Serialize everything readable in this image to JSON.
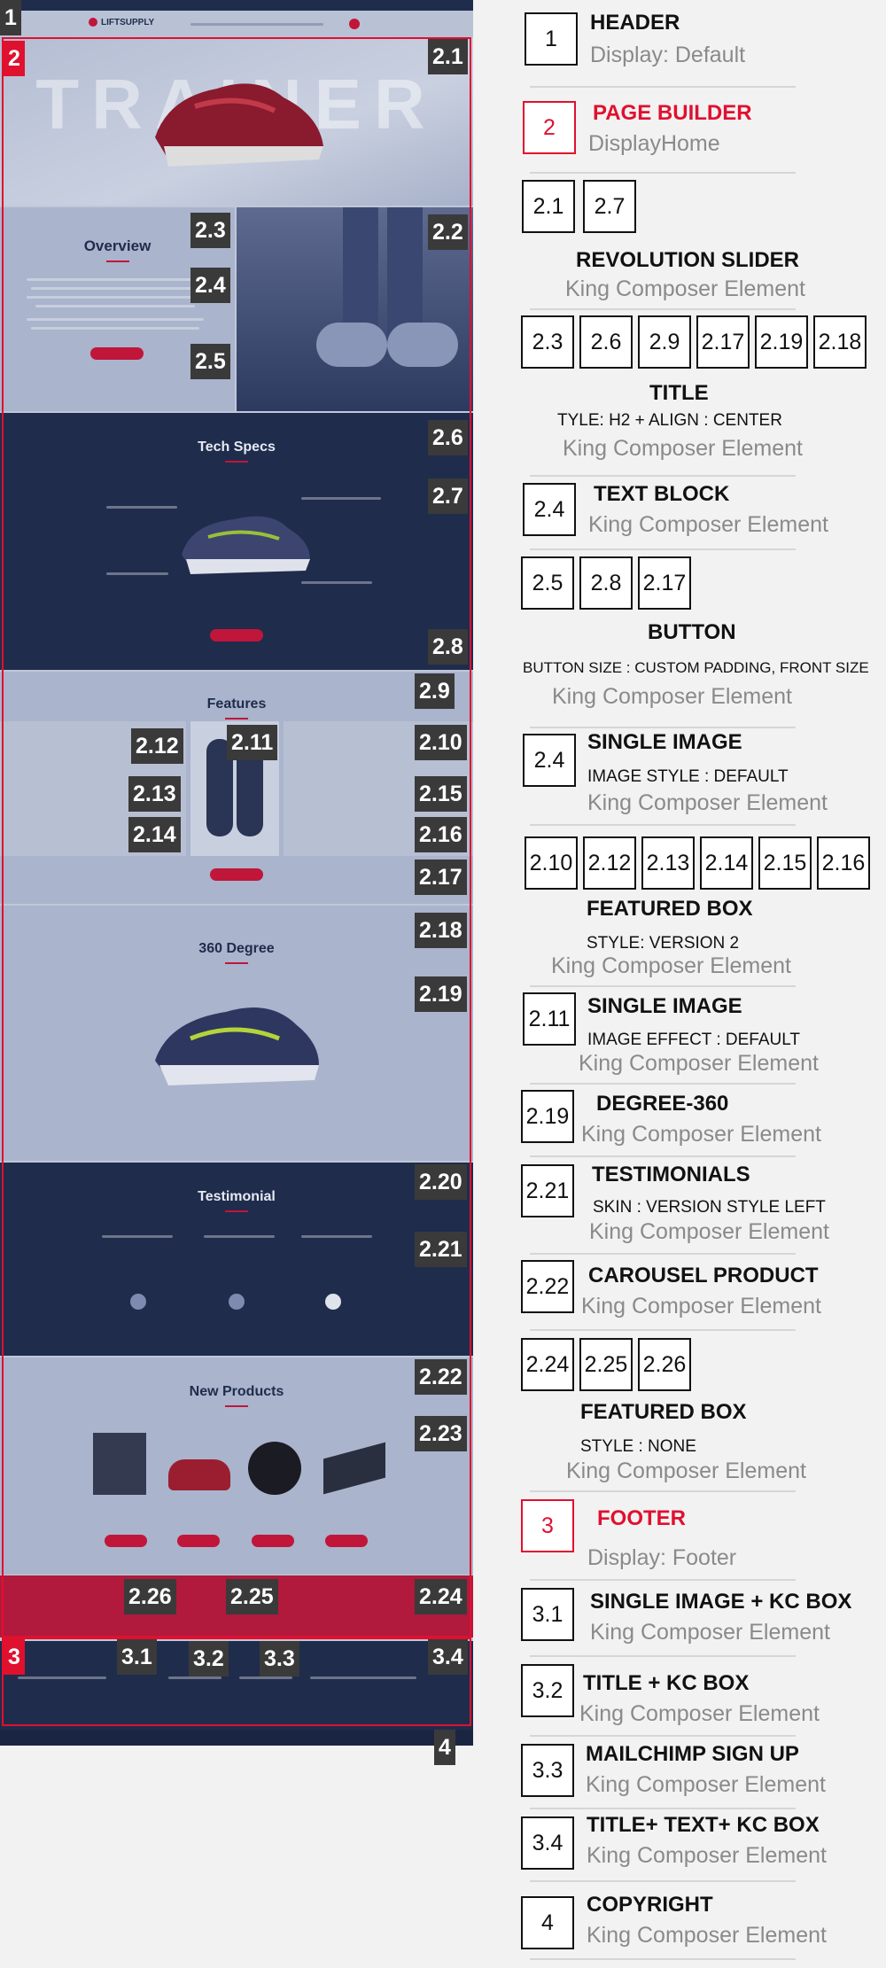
{
  "mockup": {
    "brand": "LIFTSUPPLY",
    "hero_word": "TRAINER",
    "overview_title": "Overview",
    "tech_title": "Tech Specs",
    "features_title": "Features",
    "degree_title": "360 Degree",
    "testimonial_title": "Testimonial",
    "products_title": "New Products",
    "labels": [
      "2",
      "2.1",
      "2.2",
      "2.3",
      "2.4",
      "2.5",
      "2.6",
      "2.7",
      "2.8",
      "2.9",
      "2.10",
      "2.11",
      "2.12",
      "2.13",
      "2.14",
      "2.15",
      "2.16",
      "2.17",
      "2.18",
      "2.19",
      "2.20",
      "2.21",
      "2.22",
      "2.23",
      "2.24",
      "2.25",
      "2.26",
      "3",
      "3.1",
      "3.2",
      "3.3",
      "3.4",
      "1",
      "4"
    ]
  },
  "legend": {
    "items": [
      {
        "boxes": [
          "1"
        ],
        "title": "HEADER",
        "subtitle": "Display: Default"
      },
      {
        "boxes": [
          "2"
        ],
        "title": "PAGE BUILDER",
        "subtitle": "DisplayHome",
        "red": true
      },
      {
        "boxes": [
          "2.1",
          "2.7"
        ],
        "title": "REVOLUTION SLIDER",
        "subtitle": "King Composer Element"
      },
      {
        "boxes": [
          "2.3",
          "2.6",
          "2.9",
          "2.17",
          "2.19",
          "2.18"
        ],
        "title": "TITLE",
        "note": "TYLE: H2 + ALIGN : CENTER",
        "subtitle": "King Composer Element"
      },
      {
        "boxes": [
          "2.4"
        ],
        "title": "TEXT BLOCK",
        "subtitle": "King Composer Element"
      },
      {
        "boxes": [
          "2.5",
          "2.8",
          "2.17"
        ],
        "title": "BUTTON",
        "note": "BUTTON SIZE : CUSTOM PADDING, FRONT SIZE",
        "subtitle": "King Composer Element"
      },
      {
        "boxes": [
          "2.4"
        ],
        "title": "SINGLE IMAGE",
        "note": "IMAGE STYLE : DEFAULT",
        "subtitle": "King Composer Element"
      },
      {
        "boxes": [
          "2.10",
          "2.12",
          "2.13",
          "2.14",
          "2.15",
          "2.16"
        ],
        "title": "FEATURED BOX",
        "note": "STYLE: VERSION 2",
        "subtitle": "King Composer Element"
      },
      {
        "boxes": [
          "2.11"
        ],
        "title": "SINGLE IMAGE",
        "note": "IMAGE EFFECT : DEFAULT",
        "subtitle": "King Composer Element"
      },
      {
        "boxes": [
          "2.19"
        ],
        "title": "DEGREE-360",
        "subtitle": "King Composer Element"
      },
      {
        "boxes": [
          "2.21"
        ],
        "title": "TESTIMONIALS",
        "note": "SKIN : VERSION STYLE LEFT",
        "subtitle": "King Composer Element"
      },
      {
        "boxes": [
          "2.22"
        ],
        "title": "CAROUSEL PRODUCT",
        "subtitle": "King Composer Element"
      },
      {
        "boxes": [
          "2.24",
          "2.25",
          "2.26"
        ],
        "title": "FEATURED BOX",
        "note": "STYLE : NONE",
        "subtitle": "King Composer Element"
      },
      {
        "boxes": [
          "3"
        ],
        "title": "FOOTER",
        "subtitle": "Display: Footer",
        "red": true
      },
      {
        "boxes": [
          "3.1"
        ],
        "title": "SINGLE IMAGE + KC BOX",
        "subtitle": "King Composer Element"
      },
      {
        "boxes": [
          "3.2"
        ],
        "title": "TITLE  + KC BOX",
        "subtitle": "King Composer Element"
      },
      {
        "boxes": [
          "3.3"
        ],
        "title": "MAILCHIMP SIGN UP",
        "subtitle": "King Composer Element"
      },
      {
        "boxes": [
          "3.4"
        ],
        "title": "TITLE+ TEXT+ KC BOX",
        "subtitle": "King Composer Element"
      },
      {
        "boxes": [
          "4"
        ],
        "title": "COPYRIGHT",
        "subtitle": "King Composer Element"
      }
    ]
  },
  "colors": {
    "accent": "#e0102f",
    "navy": "#1f2c4c",
    "pale": "#aab4cc"
  }
}
